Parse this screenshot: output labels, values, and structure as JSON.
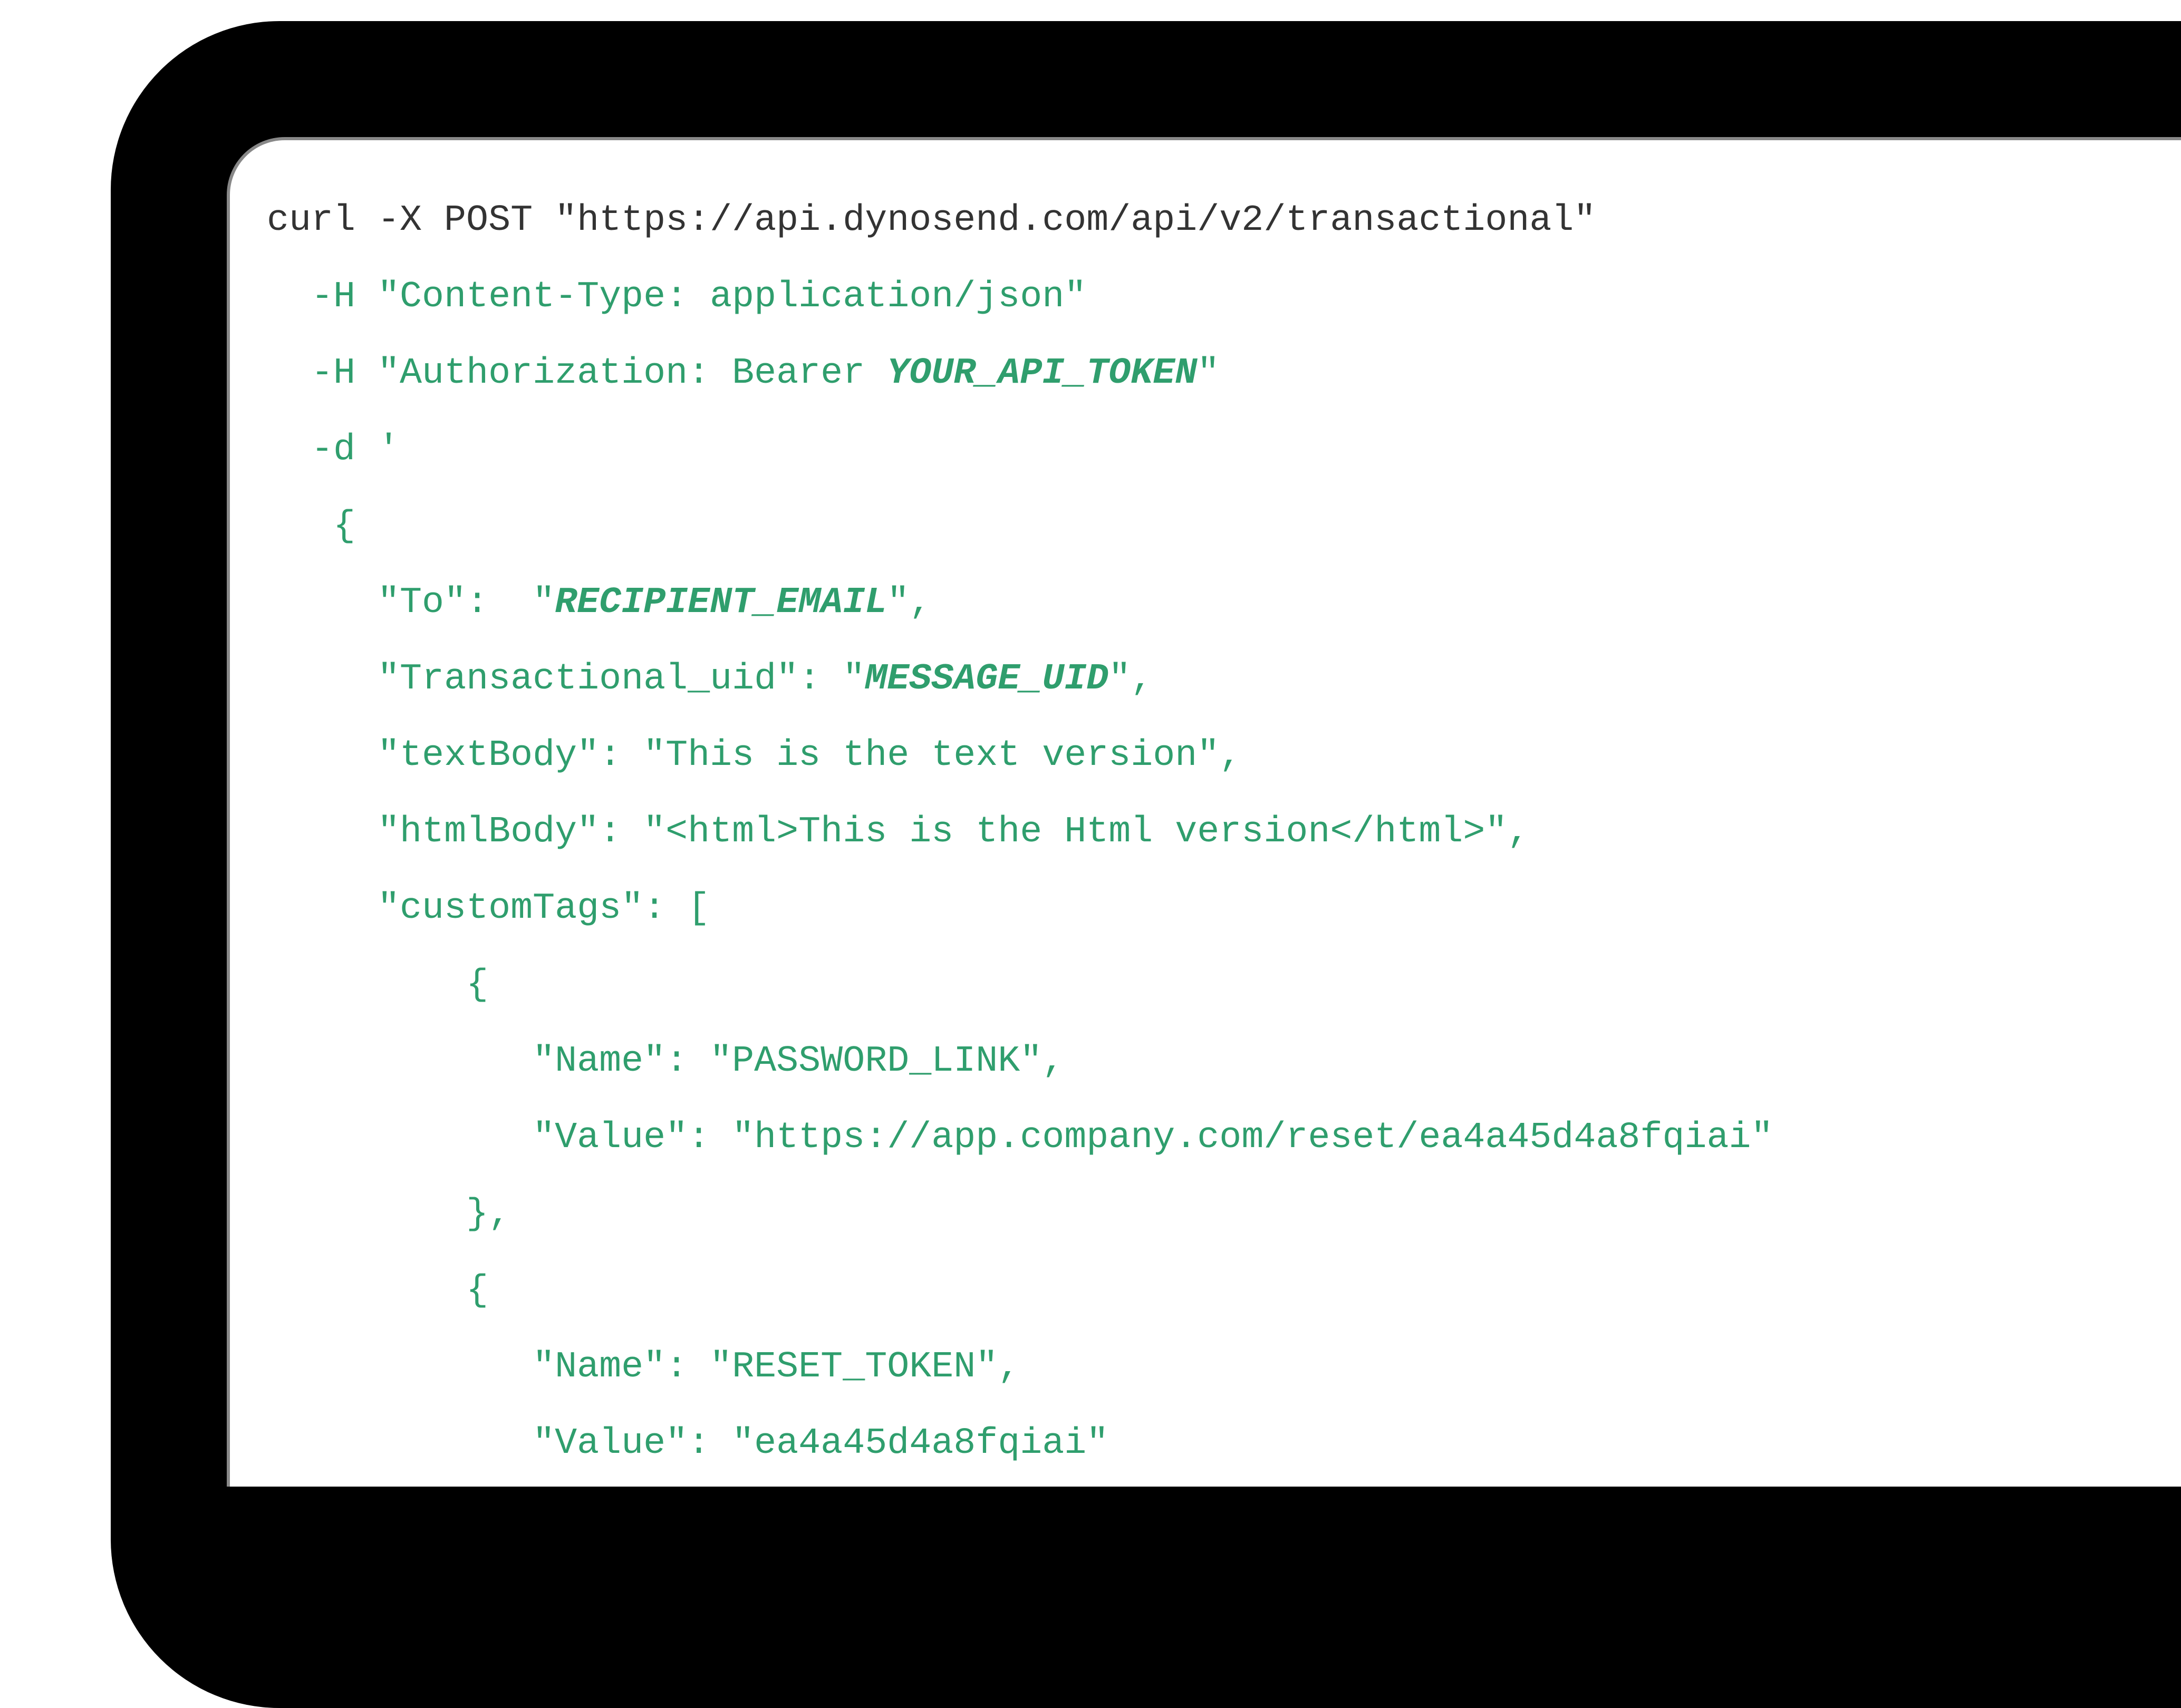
{
  "code": {
    "cmd_prefix": "curl -X POST ",
    "url": "\"https://api.dynosend.com/api/v2/transactional\"",
    "flag_H": "-H",
    "flag_d": "-d",
    "header1_open": "\"Content-Type: application/json\"",
    "header2_open": "\"Authorization: Bearer ",
    "api_token": "YOUR_API_TOKEN",
    "header2_close": "\"",
    "d_open": "'",
    "brace_open": "{",
    "to_key": "\"To\":  ",
    "to_open": "\"",
    "recipient": "RECIPIENT_EMAIL",
    "to_close": "\",",
    "tuid_key": "\"Transactional_uid\": ",
    "tuid_open": "\"",
    "message_uid": "MESSAGE_UID",
    "tuid_close": "\",",
    "textBody": "\"textBody\": \"This is the text version\",",
    "htmlBody": "\"htmlBody\": \"<html>This is the Html version</html>\",",
    "customTags_open": "\"customTags\": [",
    "obj_open": "{",
    "tag1_name": "\"Name\": \"PASSWORD_LINK\",",
    "tag1_value": "\"Value\": \"https://app.company.com/reset/ea4a45d4a8fqiai\"",
    "obj_close_comma": "},",
    "tag2_name": "\"Name\": \"RESET_TOKEN\",",
    "tag2_value": "\"Value\": \"ea4a45d4a8fqiai\""
  }
}
